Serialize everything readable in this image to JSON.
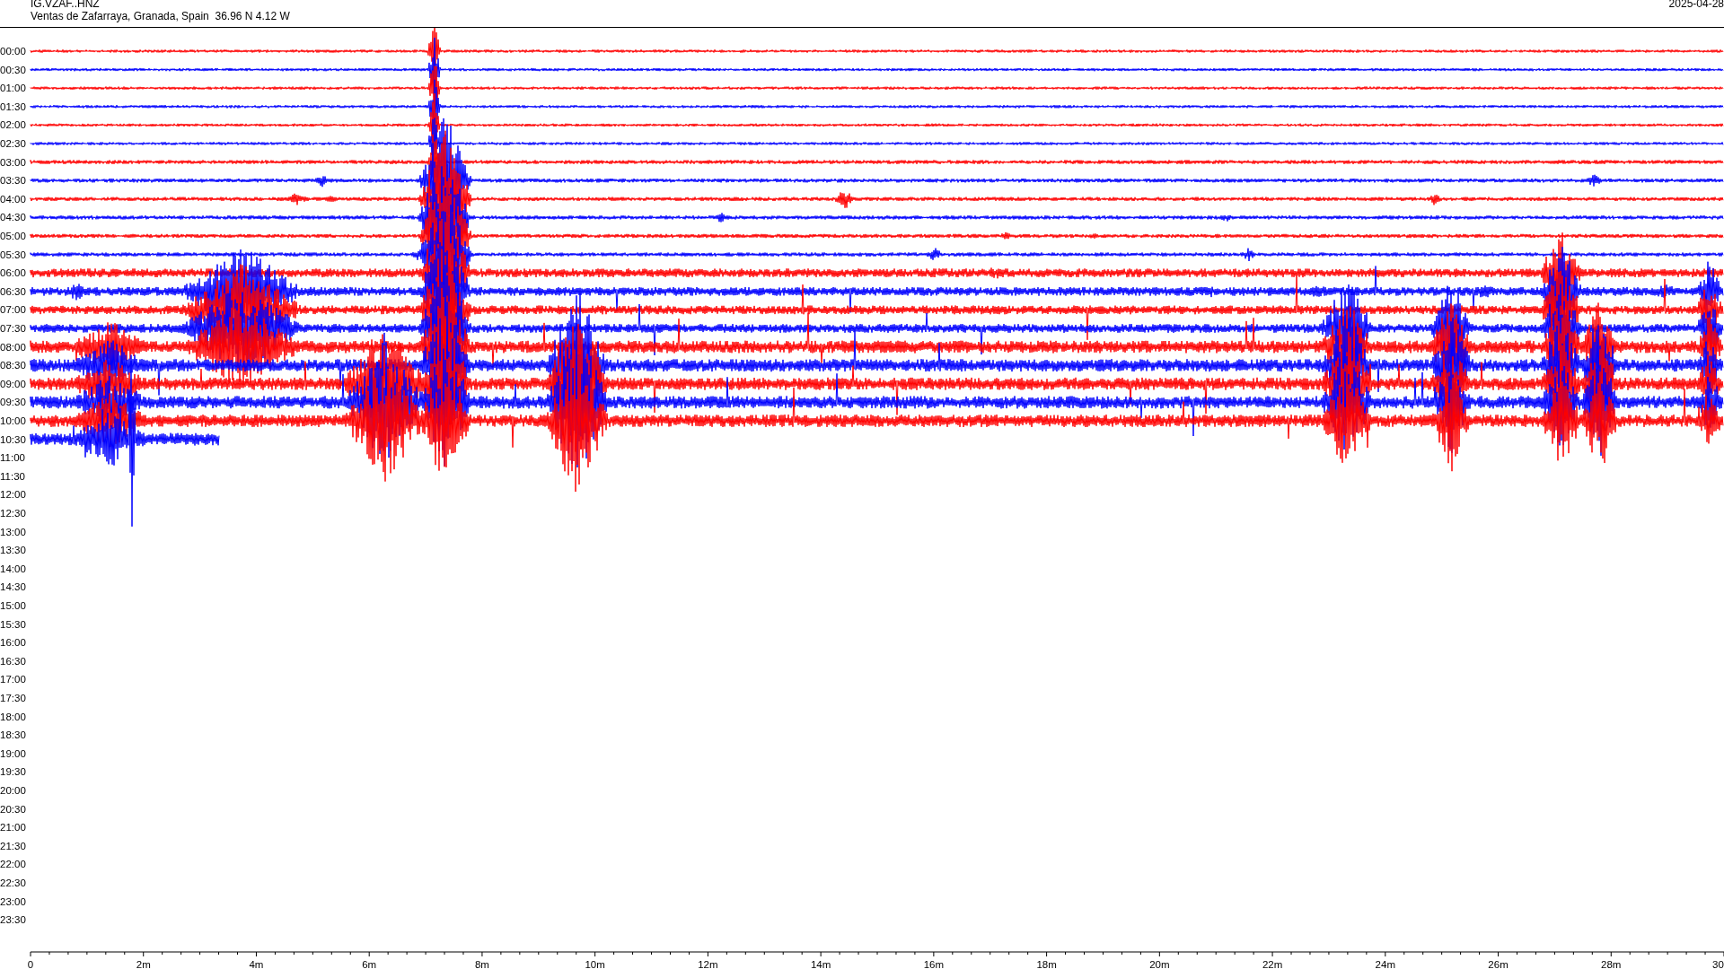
{
  "header": {
    "station": "IG.VZAF..HNZ",
    "location": "Ventas de Zafarraya, Granada, Spain  36.96 N 4.12 W",
    "date": "2025-04-28"
  },
  "hour_labels": [
    "00:00",
    "00:30",
    "01:00",
    "01:30",
    "02:00",
    "02:30",
    "03:00",
    "03:30",
    "04:00",
    "04:30",
    "05:00",
    "05:30",
    "06:00",
    "06:30",
    "07:00",
    "07:30",
    "08:00",
    "08:30",
    "09:00",
    "09:30",
    "10:00",
    "10:30",
    "11:00",
    "11:30",
    "12:00",
    "12:30",
    "13:00",
    "13:30",
    "14:00",
    "14:30",
    "15:00",
    "15:30",
    "16:00",
    "16:30",
    "17:00",
    "17:30",
    "18:00",
    "18:30",
    "19:00",
    "19:30",
    "20:00",
    "20:30",
    "21:00",
    "21:30",
    "22:00",
    "22:30",
    "23:00",
    "23:30"
  ],
  "x_axis": {
    "labels": [
      "0",
      "2m",
      "4m",
      "6m",
      "8m",
      "10m",
      "12m",
      "14m",
      "16m",
      "18m",
      "20m",
      "22m",
      "24m",
      "26m",
      "28m",
      "30"
    ]
  }
}
